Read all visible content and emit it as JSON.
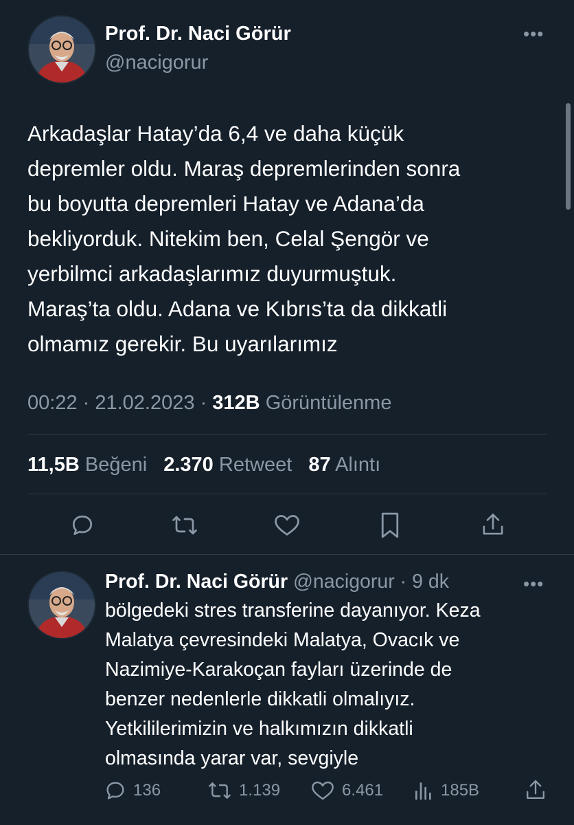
{
  "tweet": {
    "author_name": "Prof. Dr. Naci Görür",
    "author_handle": "@nacigorur",
    "text": "Arkadaşlar Hatay’da 6,4 ve daha küçük\ndepremler oldu. Maraş depremlerinden sonra\nbu boyutta depremleri Hatay ve Adana’da\nbekliyorduk. Nitekim ben, Celal Şengör ve\nyerbilmci arkadaşlarımız duyurmuştuk.\nMaraş’ta oldu. Adana ve Kıbrıs’ta da dikkatli\nolmamız gerekir. Bu uyarılarımız",
    "time": "00:22",
    "date": "21.02.2023",
    "views_count": "312B",
    "views_label": "Görüntülenme",
    "likes_count": "11,5B",
    "likes_label": "Beğeni",
    "retweets_count": "2.370",
    "retweets_label": "Retweet",
    "quotes_count": "87",
    "quotes_label": "Alıntı",
    "more_label": "•••"
  },
  "reply": {
    "author_name": "Prof. Dr. Naci Görür",
    "author_handle": "@nacigorur",
    "time_ago": "9 dk",
    "text": "bölgedeki stres transferine dayanıyor. Keza\nMalatya çevresindeki Malatya, Ovacık ve\nNazimiye-Karakoçan fayları üzerinde de\nbenzer nedenlerle dikkatli olmalıyız.\nYetkililerimizin ve halkımızın dikkatli\nolmasında yarar var, sevgiyle",
    "reply_count": "136",
    "retweet_count": "1.139",
    "like_count": "6.461",
    "views_count": "185B",
    "more_label": "•••"
  },
  "icons": {
    "reply": "reply-icon",
    "retweet": "retweet-icon",
    "like": "heart-icon",
    "bookmark": "bookmark-icon",
    "share": "share-icon",
    "views": "views-icon"
  },
  "colors": {
    "background": "#15202b",
    "text": "#ffffff",
    "muted": "#8b98a5",
    "divider": "#2f3b47"
  }
}
